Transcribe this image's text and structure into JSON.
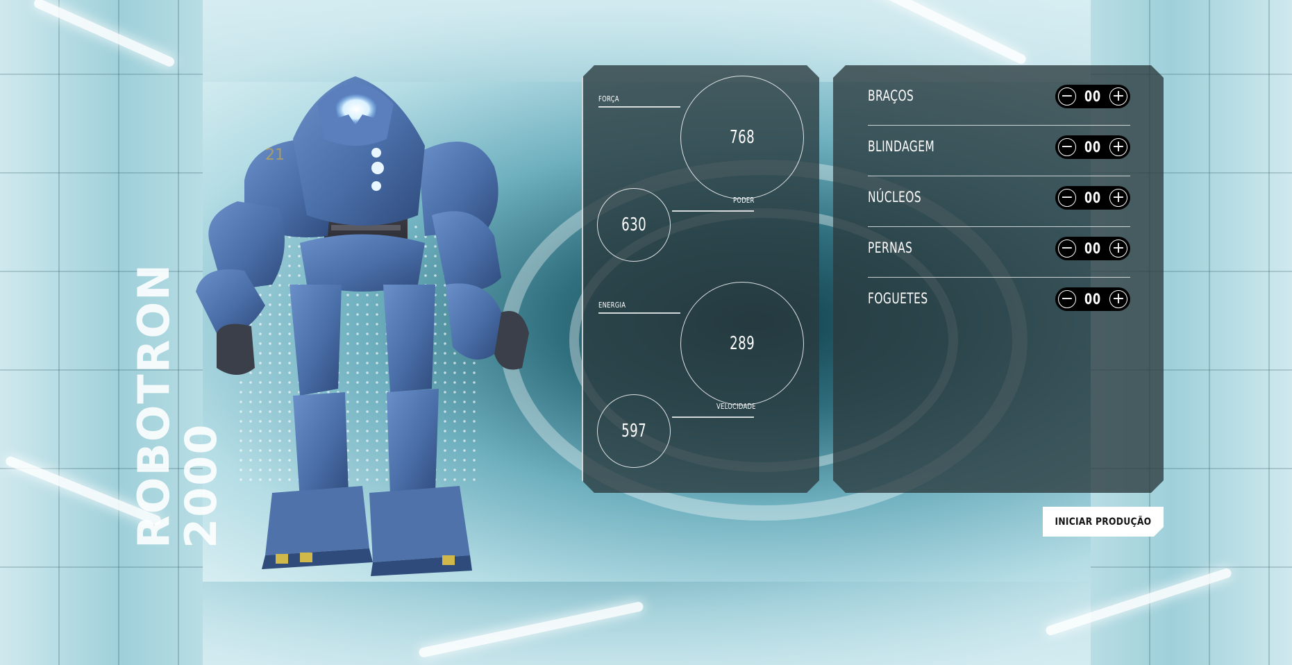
{
  "title": {
    "line1": "ROBOTRON",
    "line2": "2000"
  },
  "stats": [
    {
      "label": "FORÇA",
      "value": "768"
    },
    {
      "label": "PODER",
      "value": "630"
    },
    {
      "label": "ENERGIA",
      "value": "289"
    },
    {
      "label": "VELOCIDADE",
      "value": "597"
    }
  ],
  "parts": [
    {
      "name": "BRAÇOS",
      "quantity": "00"
    },
    {
      "name": "BLINDAGEM",
      "quantity": "00"
    },
    {
      "name": "NÚCLEOS",
      "quantity": "00"
    },
    {
      "name": "PERNAS",
      "quantity": "00"
    },
    {
      "name": "FOGUETES",
      "quantity": "00"
    }
  ],
  "stepper": {
    "minus": "−",
    "plus": "+"
  },
  "cta": {
    "label": "INICIAR PRODUÇÃO"
  },
  "colors": {
    "panel": "#2a3a3e",
    "robot_body": "#4a6ea8",
    "cta_background": "#ffffff",
    "cta_text": "#111111"
  },
  "icons": [
    "minus-icon",
    "plus-icon"
  ]
}
